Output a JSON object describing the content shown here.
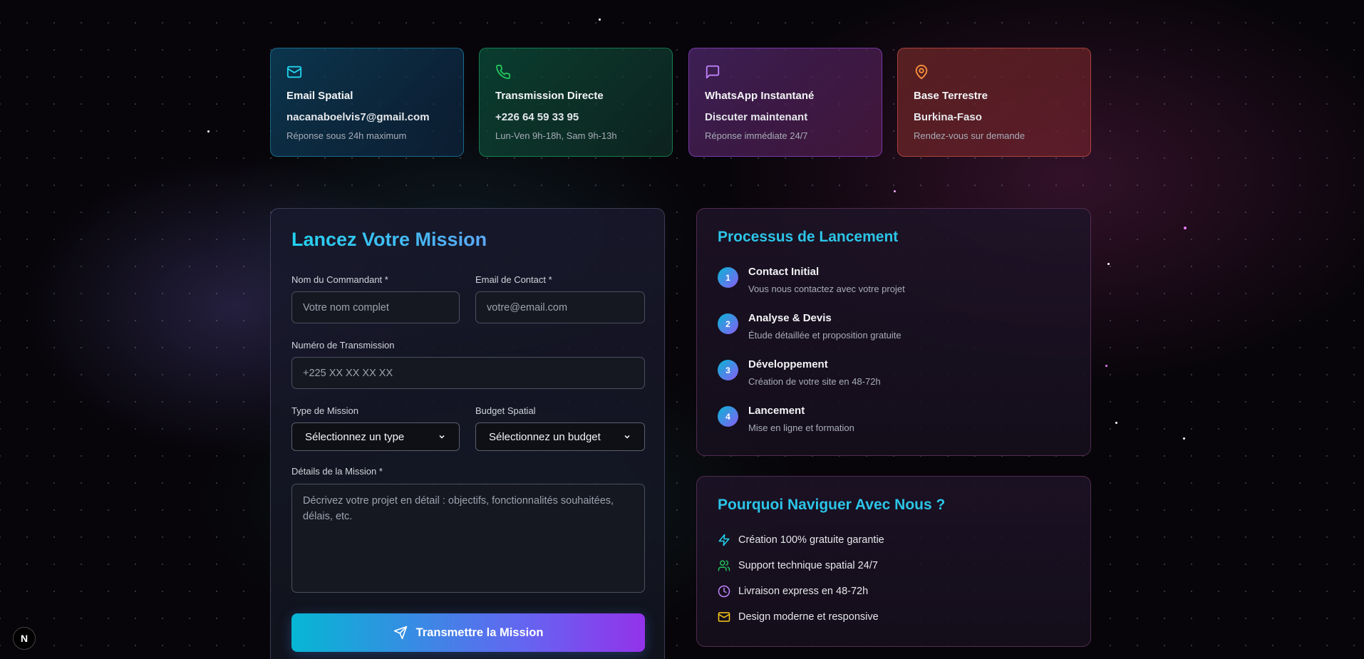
{
  "contact_cards": [
    {
      "icon": "mail-icon",
      "title": "Email Spatial",
      "value": "nacanaboelvis7@gmail.com",
      "subtitle": "Réponse sous 24h maximum",
      "accent": "#22d3ee"
    },
    {
      "icon": "phone-icon",
      "title": "Transmission Directe",
      "value": "+226 64 59 33 95",
      "subtitle": "Lun-Ven 9h-18h, Sam 9h-13h",
      "accent": "#22c55e"
    },
    {
      "icon": "message-icon",
      "title": "WhatsApp Instantané",
      "value": "Discuter maintenant",
      "subtitle": "Réponse immédiate 24/7",
      "accent": "#c084fc"
    },
    {
      "icon": "map-pin-icon",
      "title": "Base Terrestre",
      "value": "Burkina-Faso",
      "subtitle": "Rendez-vous sur demande",
      "accent": "#fb923c"
    }
  ],
  "form": {
    "title": "Lancez Votre Mission",
    "name_label": "Nom du Commandant *",
    "name_placeholder": "Votre nom complet",
    "email_label": "Email de Contact *",
    "email_placeholder": "votre@email.com",
    "phone_label": "Numéro de Transmission",
    "phone_placeholder": "+225 XX XX XX XX",
    "type_label": "Type de Mission",
    "type_value": "Sélectionnez un type",
    "budget_label": "Budget Spatial",
    "budget_value": "Sélectionnez un budget",
    "details_label": "Détails de la Mission *",
    "details_placeholder": "Décrivez votre projet en détail : objectifs, fonctionnalités souhaitées, délais, etc.",
    "submit_label": "Transmettre la Mission"
  },
  "process": {
    "title": "Processus de Lancement",
    "steps": [
      {
        "num": "1",
        "title": "Contact Initial",
        "desc": "Vous nous contactez avec votre projet"
      },
      {
        "num": "2",
        "title": "Analyse & Devis",
        "desc": "Étude détaillée et proposition gratuite"
      },
      {
        "num": "3",
        "title": "Développement",
        "desc": "Création de votre site en 48-72h"
      },
      {
        "num": "4",
        "title": "Lancement",
        "desc": "Mise en ligne et formation"
      }
    ]
  },
  "why": {
    "title": "Pourquoi Naviguer Avec Nous ?",
    "features": [
      {
        "icon": "zap-icon",
        "text": "Création 100% gratuite garantie",
        "color": "#22d3ee"
      },
      {
        "icon": "users-icon",
        "text": "Support technique spatial 24/7",
        "color": "#22c55e"
      },
      {
        "icon": "clock-icon",
        "text": "Livraison express en 48-72h",
        "color": "#c084fc"
      },
      {
        "icon": "mail-icon",
        "text": "Design moderne et responsive",
        "color": "#facc15"
      }
    ]
  },
  "dev_badge": "N"
}
